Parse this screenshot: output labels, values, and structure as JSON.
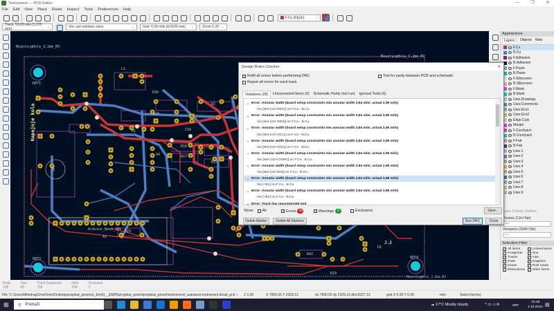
{
  "window": {
    "title": "*instrument — PCB Editor",
    "minimize": "—",
    "restore": "❐",
    "close": "✕"
  },
  "menu": [
    "File",
    "Edit",
    "View",
    "Place",
    "Route",
    "Inspect",
    "Tools",
    "Preferences",
    "Help"
  ],
  "toolbar_icons": [
    "save-icon",
    "board-setup-icon",
    "sep",
    "page-settings-icon",
    "print-icon",
    "plot-icon",
    "sep",
    "undo-icon",
    "redo-icon",
    "sep",
    "find-icon",
    "sep",
    "refresh-icon",
    "zoom-in-icon",
    "zoom-out-icon",
    "zoom-fit-icon",
    "zoom-objects-icon",
    "zoom-selection-icon",
    "sep",
    "rotate-ccw-icon",
    "rotate-cw-icon",
    "flip-horizontal-icon",
    "flip-vertical-icon",
    "sep",
    "group-icon",
    "ungroup-icon",
    "lock-icon",
    "unlock-icon",
    "sep",
    "netlist-update-icon",
    "footprint-library-icon",
    "sep",
    "drc-icon",
    "scripting-icon"
  ],
  "toolbar2": {
    "track": "Track: 50,00 mils (1,270 mm)",
    "via": "Via: use netclass sizes",
    "grid": "Grid: 0,39 mils (0,0100 mm)",
    "zoom": "Zoom 2,20",
    "layer": "F.Cu (PgUp)"
  },
  "left_tools": [
    "grid-icon",
    "polar-icon",
    "units-mils-icon",
    "units-mm-icon",
    "pixel-icon",
    "cursor-icon",
    "ratsnest-icon",
    "local-ratsnest-icon",
    "track-outline-icon",
    "via-outline-icon",
    "zone-fill-icon",
    "zone-outline-icon",
    "net-colors-icon",
    "highcontrast-icon",
    "appearance-icon",
    "layers-manager-icon",
    "drc-markers-icon"
  ],
  "right_tools": [
    "select-icon",
    "close-icon",
    "route-icon",
    "diff-pair-icon",
    "tune-icon",
    "via-icon",
    "zone-icon",
    "rule-area-icon",
    "line-icon",
    "arc-icon",
    "rect-icon",
    "circle-icon",
    "polygon-icon",
    "text-icon",
    "textbox-icon",
    "dimension-icon",
    "anchor-icon",
    "origin-icon",
    "measure-icon"
  ],
  "pcb": {
    "labels": [
      {
        "id": "mh1",
        "text": "MountingHole_3.2mm_M3"
      },
      {
        "id": "mh2",
        "text": "MountingHole_3.2mm_M3"
      },
      {
        "id": "mh3",
        "text": "MountingHole_3.2mm_M3"
      },
      {
        "id": "ref1",
        "text": "REF1"
      },
      {
        "id": "ref2",
        "text": "REF3"
      },
      {
        "id": "ref4",
        "text": "REF4"
      },
      {
        "id": "nap",
        "text": "Napajnje kola"
      },
      {
        "id": "ard",
        "text": "Arduino_Nano_30x"
      },
      {
        "id": "a1",
        "text": "A1"
      },
      {
        "id": "sw2",
        "text": "SW2"
      },
      {
        "id": "l1",
        "text": "L1"
      },
      {
        "id": "r30",
        "text": "R30"
      },
      {
        "id": "r29",
        "text": "R29"
      },
      {
        "id": "r1",
        "text": "R1"
      },
      {
        "id": "r16",
        "text": "R16"
      },
      {
        "id": "r17",
        "text": "R17"
      },
      {
        "id": "r23",
        "text": "R23"
      },
      {
        "id": "r25",
        "text": "R25"
      },
      {
        "id": "r42",
        "text": "R42"
      },
      {
        "id": "r10",
        "text": "R10"
      },
      {
        "id": "d2",
        "text": "D2"
      },
      {
        "id": "c16",
        "text": "C16"
      },
      {
        "id": "u1",
        "text": "U1"
      },
      {
        "id": "u4",
        "text": "U4"
      },
      {
        "id": "j12",
        "text": "J.2"
      }
    ]
  },
  "drc": {
    "title": "Design Rules Checker",
    "close": "✕",
    "refill": "Refill all zones before performing DRC",
    "report_all": "Report all errors for each track",
    "parity": "Test for parity between PCB and schematic",
    "tabs": [
      "Violations (28)",
      "Unconnected Items (0)",
      "Schematic Parity (not run)",
      "Ignored Tests (4)"
    ],
    "violations": [
      {
        "error": "Error: Annular width (board setup constraints min annular width 3,94 mils; actual 2,95 mils)",
        "item": "Via [Net-(U3-SW1)] on F.Cu - B.Cu"
      },
      {
        "error": "Error: Annular width (board setup constraints min annular width 3,94 mils; actual 2,95 mils)",
        "item": "Via [Net-(U3-SW2)] on F.Cu - B.Cu"
      },
      {
        "error": "Error: Annular width (board setup constraints min annular width 3,94 mils; actual 2,95 mils)",
        "item": "Via [Net-(U3-VCC)] on F.Cu - B.Cu"
      },
      {
        "error": "Error: Annular width (board setup constraints min annular width 3,94 mils; actual 2,95 mils)",
        "item": "Via [Net-(U3-VCC)] on F.Cu - B.Cu"
      },
      {
        "error": "Error: Annular width (board setup constraints min annular width 3,94 mils; actual 2,95 mils)",
        "item": "Via [Net-(U3-COMP)] on F.Cu - B.Cu"
      },
      {
        "error": "Error: Annular width (board setup constraints min annular width 3,94 mils; actual 2,95 mils)",
        "item": "Via [Net-(U3-ISN)] on F.Cu - B.Cu"
      },
      {
        "error": "Error: Annular width (board setup constraints min annular width 3,94 mils; actual 2,95 mils)",
        "item": "Via [+5V] on F.Cu - B.Cu"
      },
      {
        "error": "Error: Annular width (board setup constraints min annular width 3,94 mils; actual 2,95 mils)",
        "item": "Via [+5V] on F.Cu - B.Cu"
      },
      {
        "error": "Error: Track has unconnected end",
        "item": ""
      }
    ],
    "show": "Show:",
    "all": "All",
    "errors": "Errors",
    "errors_count": "28",
    "warnings": "Warnings",
    "warnings_count": "0",
    "exclusions": "Exclusions",
    "save": "Save...",
    "delete_marker": "Delete Marker",
    "delete_all": "Delete All Markers",
    "run": "Run DRC",
    "close_btn": "Close",
    "colors": {
      "error": "#e0141e",
      "warning": "#1a9e2a"
    }
  },
  "appearance": {
    "title": "Appearance",
    "tabs": [
      "Layers",
      "Objects",
      "Nets"
    ],
    "layers": [
      {
        "name": "F.Cu",
        "color": "#c83434"
      },
      {
        "name": "B.Cu",
        "color": "#4d7fc4"
      },
      {
        "name": "F.Adhesive",
        "color": "#8a1a8a"
      },
      {
        "name": "B.Adhesive",
        "color": "#0a1a6a"
      },
      {
        "name": "F.Paste",
        "color": "#b4a08c"
      },
      {
        "name": "B.Paste",
        "color": "#00c2c2"
      },
      {
        "name": "F.Silkscreen",
        "color": "#e8e8b0"
      },
      {
        "name": "B.Silkscreen",
        "color": "#e8b4b4"
      },
      {
        "name": "F.Mask",
        "color": "#d854d8"
      },
      {
        "name": "B.Mask",
        "color": "#20c8c8"
      },
      {
        "name": "User.Drawings",
        "color": "#c2c2c2"
      },
      {
        "name": "User.Comments",
        "color": "#5984c0"
      },
      {
        "name": "User.Eco1",
        "color": "#8cb4a0"
      },
      {
        "name": "User.Eco2",
        "color": "#c8c060"
      },
      {
        "name": "Edge.Cuts",
        "color": "#d0d0a0"
      },
      {
        "name": "Margin",
        "color": "#e040e0"
      },
      {
        "name": "F.Courtyard",
        "color": "#e040d0"
      },
      {
        "name": "B.Courtyard",
        "color": "#20c8b0"
      },
      {
        "name": "F.Fab",
        "color": "#b0a0a0"
      },
      {
        "name": "B.Fab",
        "color": "#404060"
      },
      {
        "name": "User.1",
        "color": "#b0b0c8"
      },
      {
        "name": "User.2",
        "color": "#5984c0"
      },
      {
        "name": "User.3",
        "color": "#8cb4a0"
      },
      {
        "name": "User.4",
        "color": "#c0c040"
      },
      {
        "name": "User.5",
        "color": "#c0a0a0"
      },
      {
        "name": "User.6",
        "color": "#4a70b0"
      },
      {
        "name": "User.7",
        "color": "#8cb4a0"
      },
      {
        "name": "User.8",
        "color": "#c8c070"
      },
      {
        "name": "User.9",
        "color": "#d0b090"
      }
    ],
    "layer_display": "Layer Display Options",
    "presets": "Presets (Ctrl+Tab)",
    "presets_value": "---",
    "viewports": "Viewports (Shift+Tab)",
    "viewports_value": "---",
    "selection_filter": "Selection Filter",
    "filters": [
      "All items",
      "Locked items",
      "Footprints",
      "Text",
      "Tracks",
      "Vias",
      "Pads",
      "Graphics",
      "Zones",
      "Rule Areas",
      "Dimensions",
      "Other items"
    ]
  },
  "stats": [
    {
      "label": "Pads",
      "value": "328"
    },
    {
      "label": "Vias",
      "value": "68"
    },
    {
      "label": "Track Segments",
      "value": "758"
    },
    {
      "label": "Nets",
      "value": "108"
    },
    {
      "label": "Unrouted",
      "value": "0"
    }
  ],
  "status": {
    "file": "File 'C:\\Users\\Milodrag\\OneDrive\\Desktop\\projekat_priumo1_Em41__EM09\\projekat_priumi\\projekat_priumi\\instrument\\_autosave-instrument.kicad_pcb' sav...",
    "zoom": "Z 2,36",
    "xy": "X 7890,55  Y 2329,13",
    "dxy": "dx 7890,55  dy 2329,13  dist 8227,13",
    "grid": "grid X 0,39  Y 0,39",
    "units": "mils",
    "mode": "Select item(s)"
  },
  "taskbar": {
    "search": "Pretraži",
    "weather": "17°C  Mostly cloudy",
    "lang": "SRP",
    "time": "21:26",
    "date": "1.10.2023.",
    "apps": [
      "task-view-icon",
      "edge-icon",
      "file-explorer-icon",
      "store-icon",
      "mail-icon",
      "sublime-icon",
      "firefox-icon",
      "files-icon",
      "terminal-icon",
      "kicad-icon"
    ]
  }
}
